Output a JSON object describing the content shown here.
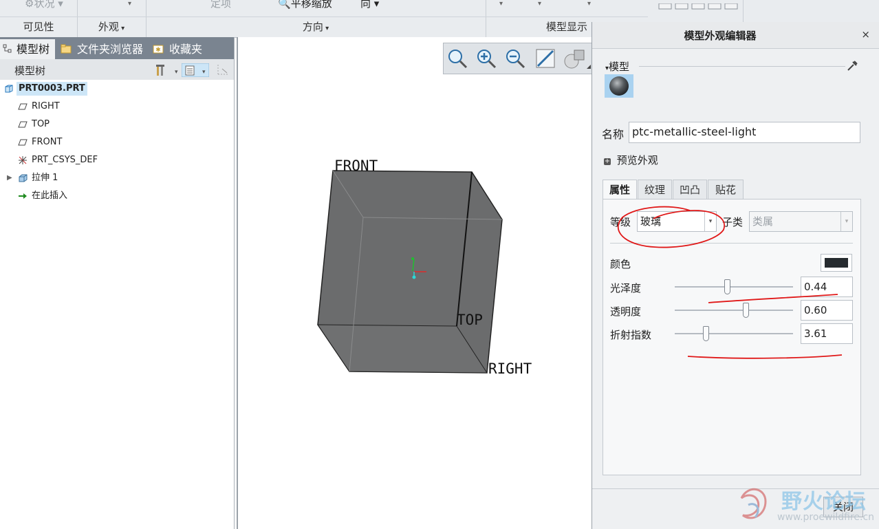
{
  "ribbon": {
    "top_items": {
      "status": "状况",
      "orient": "定项",
      "pan_zoom": "平移缩放",
      "direction_partial": "向"
    },
    "groups": {
      "visibility": "可见性",
      "appearance": "外观",
      "orientation": "方向",
      "model_display": "模型显示"
    }
  },
  "left_panel": {
    "tabs": [
      {
        "label": "模型树"
      },
      {
        "label": "文件夹浏览器"
      },
      {
        "label": "收藏夹"
      }
    ],
    "tree_header": "模型树",
    "tree": [
      {
        "label": "PRT0003.PRT",
        "icon": "part-icon",
        "selected": true
      },
      {
        "label": "RIGHT",
        "icon": "datum-plane-icon"
      },
      {
        "label": "TOP",
        "icon": "datum-plane-icon"
      },
      {
        "label": "FRONT",
        "icon": "datum-plane-icon"
      },
      {
        "label": "PRT_CSYS_DEF",
        "icon": "csys-icon"
      },
      {
        "label": "拉伸 1",
        "icon": "extrude-icon",
        "expandable": true
      },
      {
        "label": "在此插入",
        "icon": "insert-arrow-icon"
      }
    ]
  },
  "viewport": {
    "labels": {
      "front": "FRONT",
      "top": "TOP",
      "right": "RIGHT"
    },
    "tools": [
      "zoom-window-icon",
      "zoom-in-icon",
      "zoom-out-icon",
      "refit-icon",
      "display-style-icon"
    ],
    "cube_color": "#6b6c6d"
  },
  "dialog": {
    "title": "模型外观编辑器",
    "close_glyph": "×",
    "model_section": "模型",
    "name_label": "名称",
    "name_value": "ptc-metallic-steel-light",
    "preview_label": "预览外观",
    "tabs": [
      "属性",
      "纹理",
      "凹凸",
      "贴花"
    ],
    "class_label": "等级",
    "class_value": "玻璃",
    "subclass_label": "子类",
    "subclass_value": "类属",
    "color_label": "颜色",
    "color_swatch": "#262b2f",
    "gloss_label": "光泽度",
    "gloss_value": "0.44",
    "transparency_label": "透明度",
    "transparency_value": "0.60",
    "refraction_label": "折射指数",
    "refraction_value": "3.61",
    "close_button": "关闭"
  },
  "watermark": {
    "brand": "野火论坛",
    "url": "www.proewildfire.cn"
  },
  "colors": {
    "annotation_red": "#e01818",
    "tab_bar": "#7a8490",
    "selection": "#cde6f7"
  }
}
